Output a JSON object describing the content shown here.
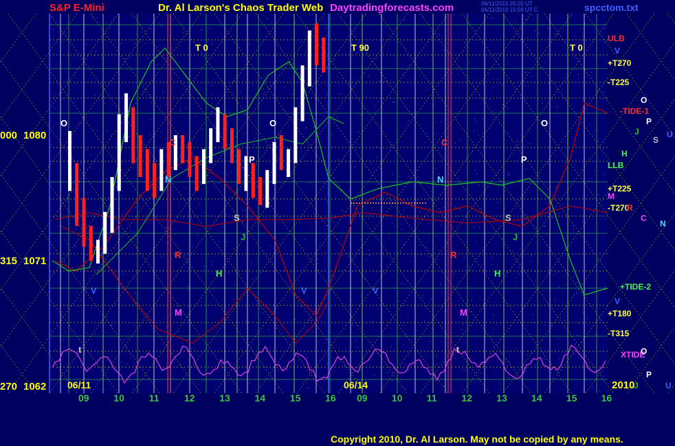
{
  "header": {
    "symbol": "S&P E-Mini",
    "title": "Dr. Al Larson's Chaos Trader Web",
    "website": "Daytradingforecasts.com",
    "date_line_1": "06/11/2010 20:20 UT",
    "date_line_2": "06/11/2010 15:59 UT C",
    "filename": "spcctom.txt"
  },
  "footer": {
    "copyright": "Copyright 2010, Dr. Al Larson. May not be copied by any means."
  },
  "colors": {
    "background": "#000060",
    "plot_background": "#000070",
    "frame": "#4060ff",
    "grid_yellow": "#e0e000",
    "grid_green": "#40c040",
    "price_up": "#ffffff",
    "price_down": "#ff2020",
    "xtide": "#e040e0",
    "curve_red": "#c00000",
    "curve_green": "#20c020",
    "copyright": "#ffff00"
  },
  "chart_data": {
    "type": "candlestick",
    "title": "S&P E-Mini",
    "y_axis": {
      "ticks": [
        {
          "angle": "000",
          "price": 1080
        },
        {
          "angle": "315",
          "price": 1071
        },
        {
          "angle": "270",
          "price": 1062
        }
      ],
      "ylim": [
        1062,
        1080
      ]
    },
    "x_axis": {
      "date_labels": [
        "06/11",
        "06/14"
      ],
      "year_label": "2010",
      "hour_ticks_day1": [
        "09",
        "10",
        "11",
        "12",
        "13",
        "14",
        "15",
        "16"
      ],
      "hour_ticks_day2": [
        "09",
        "10",
        "11",
        "12",
        "13",
        "14",
        "15",
        "16"
      ]
    },
    "price_bars_06_11": [
      {
        "hour": 8.6,
        "low": 1076.0,
        "high": 1080.3,
        "close": 1079.0
      },
      {
        "hour": 8.8,
        "low": 1073.5,
        "high": 1078.0,
        "close": 1074.5
      },
      {
        "hour": 9.0,
        "low": 1072.0,
        "high": 1075.5,
        "close": 1073.0
      },
      {
        "hour": 9.2,
        "low": 1071.0,
        "high": 1073.5,
        "close": 1071.8
      },
      {
        "hour": 9.4,
        "low": 1070.8,
        "high": 1072.5,
        "close": 1072.0
      },
      {
        "hour": 9.6,
        "low": 1071.5,
        "high": 1074.5,
        "close": 1074.0
      },
      {
        "hour": 9.8,
        "low": 1073.0,
        "high": 1077.0,
        "close": 1076.0
      },
      {
        "hour": 10.0,
        "low": 1076.0,
        "high": 1081.5,
        "close": 1081.0
      },
      {
        "hour": 10.2,
        "low": 1079.5,
        "high": 1083.0,
        "close": 1081.5
      },
      {
        "hour": 10.4,
        "low": 1078.0,
        "high": 1082.0,
        "close": 1079.0
      },
      {
        "hour": 10.6,
        "low": 1077.0,
        "high": 1080.0,
        "close": 1078.0
      },
      {
        "hour": 10.8,
        "low": 1076.0,
        "high": 1079.0,
        "close": 1077.5
      },
      {
        "hour": 11.0,
        "low": 1075.5,
        "high": 1078.0,
        "close": 1076.0
      },
      {
        "hour": 11.2,
        "low": 1076.0,
        "high": 1079.0,
        "close": 1078.5
      },
      {
        "hour": 11.4,
        "low": 1077.0,
        "high": 1079.5,
        "close": 1077.8
      },
      {
        "hour": 11.6,
        "low": 1077.5,
        "high": 1080.0,
        "close": 1079.2
      },
      {
        "hour": 11.8,
        "low": 1078.0,
        "high": 1080.0,
        "close": 1078.5
      },
      {
        "hour": 12.0,
        "low": 1077.0,
        "high": 1079.5,
        "close": 1078.0
      },
      {
        "hour": 12.2,
        "low": 1076.0,
        "high": 1078.5,
        "close": 1077.0
      },
      {
        "hour": 12.4,
        "low": 1076.5,
        "high": 1079.0,
        "close": 1078.6
      },
      {
        "hour": 12.6,
        "low": 1078.0,
        "high": 1080.5,
        "close": 1080.0
      },
      {
        "hour": 12.8,
        "low": 1079.5,
        "high": 1082.0,
        "close": 1081.0
      },
      {
        "hour": 13.0,
        "low": 1079.0,
        "high": 1081.5,
        "close": 1079.5
      },
      {
        "hour": 13.2,
        "low": 1078.0,
        "high": 1080.5,
        "close": 1078.5
      },
      {
        "hour": 13.4,
        "low": 1076.5,
        "high": 1079.0,
        "close": 1077.0
      },
      {
        "hour": 13.6,
        "low": 1076.0,
        "high": 1078.5,
        "close": 1077.8
      },
      {
        "hour": 13.8,
        "low": 1075.5,
        "high": 1078.0,
        "close": 1076.0
      },
      {
        "hour": 14.0,
        "low": 1075.0,
        "high": 1077.0,
        "close": 1075.5
      },
      {
        "hour": 14.2,
        "low": 1074.8,
        "high": 1077.5,
        "close": 1077.0
      },
      {
        "hour": 14.4,
        "low": 1076.5,
        "high": 1079.5,
        "close": 1079.0
      },
      {
        "hour": 14.6,
        "low": 1077.5,
        "high": 1080.0,
        "close": 1078.0
      },
      {
        "hour": 14.8,
        "low": 1077.0,
        "high": 1079.0,
        "close": 1078.5
      },
      {
        "hour": 15.0,
        "low": 1078.0,
        "high": 1082.0,
        "close": 1081.5
      },
      {
        "hour": 15.2,
        "low": 1081.0,
        "high": 1085.0,
        "close": 1084.5
      },
      {
        "hour": 15.4,
        "low": 1083.5,
        "high": 1087.5,
        "close": 1086.5
      },
      {
        "hour": 15.6,
        "low": 1085.0,
        "high": 1088.0,
        "close": 1086.0
      },
      {
        "hour": 15.8,
        "low": 1084.5,
        "high": 1087.0,
        "close": 1085.5
      }
    ],
    "right_labels": [
      {
        "text": "ULB",
        "color": "#ff3030"
      },
      {
        "text": "V",
        "color": "#4060ff"
      },
      {
        "text": "+T270",
        "color": "#ffff40"
      },
      {
        "text": "-T225",
        "color": "#ffff40"
      },
      {
        "text": "O",
        "color": "#ffffff"
      },
      {
        "text": "-TIDE-1",
        "color": "#ff3030"
      },
      {
        "text": "P",
        "color": "#ffffff"
      },
      {
        "text": "J",
        "color": "#20c020"
      },
      {
        "text": "S",
        "color": "#c0c0c0"
      },
      {
        "text": "U",
        "color": "#4060ff"
      },
      {
        "text": "H",
        "color": "#40ff40"
      },
      {
        "text": "LLB",
        "color": "#40ff40"
      },
      {
        "text": "+T225",
        "color": "#ffff40"
      },
      {
        "text": "M",
        "color": "#ff40ff"
      },
      {
        "text": "-T270",
        "color": "#ffff40"
      },
      {
        "text": "R",
        "color": "#ff3030"
      },
      {
        "text": "C",
        "color": "#ff40ff"
      },
      {
        "text": "N",
        "color": "#40e0ff"
      },
      {
        "text": "+TIDE-2",
        "color": "#40ff40"
      },
      {
        "text": "V",
        "color": "#4060ff"
      },
      {
        "text": "+T180",
        "color": "#ffff40"
      },
      {
        "text": "-T315",
        "color": "#ffff40"
      },
      {
        "text": "XTIDE",
        "color": "#ff40ff"
      },
      {
        "text": "O",
        "color": "#ffffff"
      },
      {
        "text": "P",
        "color": "#ffffff"
      },
      {
        "text": "J",
        "color": "#20c020"
      },
      {
        "text": "U",
        "color": "#4060ff"
      }
    ],
    "plot_labels": [
      {
        "text": "T 0",
        "color": "#ffff40"
      },
      {
        "text": "T 90",
        "color": "#ffff40"
      },
      {
        "text": "T 0",
        "color": "#ffff40"
      },
      {
        "text": "O",
        "color": "#ffffff"
      },
      {
        "text": "O",
        "color": "#ffffff"
      },
      {
        "text": "O",
        "color": "#ffffff"
      },
      {
        "text": "C",
        "color": "#ff3030"
      },
      {
        "text": "C",
        "color": "#ff3030"
      },
      {
        "text": "N",
        "color": "#40e0ff"
      },
      {
        "text": "N",
        "color": "#40e0ff"
      },
      {
        "text": "P",
        "color": "#ffffff"
      },
      {
        "text": "P",
        "color": "#ffffff"
      },
      {
        "text": "S",
        "color": "#c0c0c0"
      },
      {
        "text": "S",
        "color": "#c0c0c0"
      },
      {
        "text": "J",
        "color": "#20c020"
      },
      {
        "text": "J",
        "color": "#20c020"
      },
      {
        "text": "H",
        "color": "#40ff40"
      },
      {
        "text": "H",
        "color": "#40ff40"
      },
      {
        "text": "M",
        "color": "#ff40ff"
      },
      {
        "text": "M",
        "color": "#ff40ff"
      },
      {
        "text": "V",
        "color": "#4060ff"
      },
      {
        "text": "V",
        "color": "#4060ff"
      },
      {
        "text": "V",
        "color": "#4060ff"
      },
      {
        "text": "R",
        "color": "#ff3030"
      },
      {
        "text": "R",
        "color": "#ff3030"
      },
      {
        "text": "t",
        "color": "#c0c0c0"
      },
      {
        "text": "t",
        "color": "#c0c0c0"
      }
    ]
  }
}
